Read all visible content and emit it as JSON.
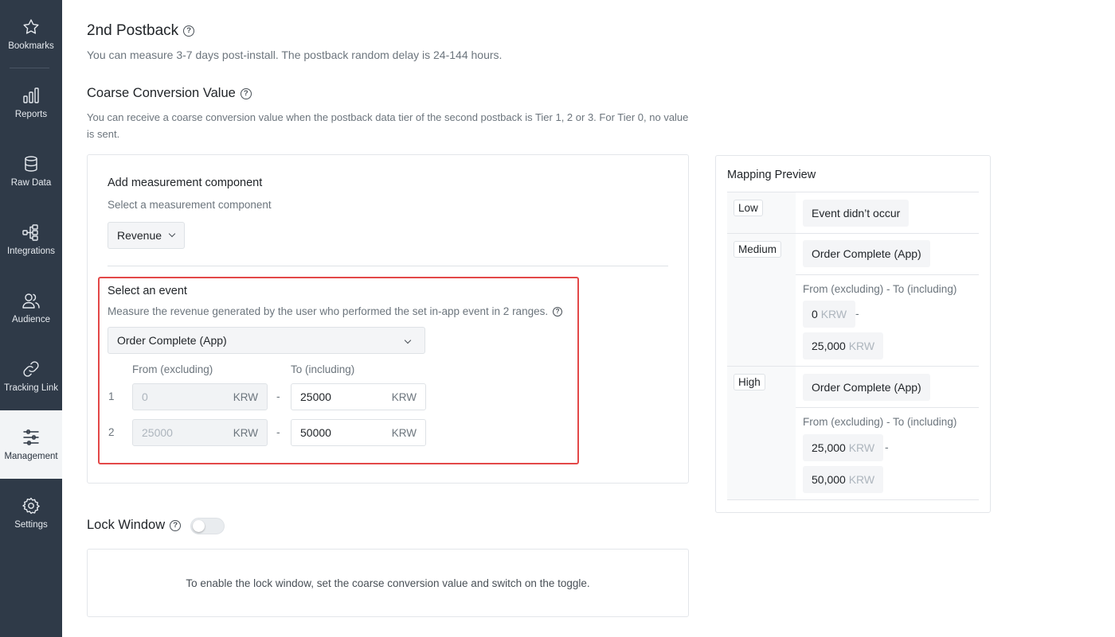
{
  "sidebar": {
    "items": [
      {
        "label": "Bookmarks",
        "icon": "star-icon"
      },
      {
        "label": "Reports",
        "icon": "bar-chart-icon"
      },
      {
        "label": "Raw Data",
        "icon": "database-icon"
      },
      {
        "label": "Integrations",
        "icon": "integrations-icon"
      },
      {
        "label": "Audience",
        "icon": "users-icon"
      },
      {
        "label": "Tracking Link",
        "icon": "link-icon"
      },
      {
        "label": "Management",
        "icon": "sliders-icon",
        "active": true
      },
      {
        "label": "Settings",
        "icon": "gear-icon"
      }
    ]
  },
  "postback": {
    "title": "2nd Postback",
    "subtitle": "You can measure 3-7 days post-install. The postback random delay is 24-144 hours."
  },
  "coarse": {
    "title": "Coarse Conversion Value",
    "description": "You can receive a coarse conversion value when the postback data tier of the second postback is Tier 1, 2 or 3. For Tier 0, no value is sent.",
    "add_component_label": "Add measurement component",
    "select_component_hint": "Select a measurement component",
    "component_value": "Revenue",
    "select_event_label": "Select an event",
    "select_event_desc": "Measure the revenue generated by the user who performed the set in-app event in 2 ranges.",
    "event_value": "Order Complete (App)",
    "from_header": "From (excluding)",
    "to_header": "To (including)",
    "ranges": [
      {
        "no": "1",
        "from": "0",
        "to": "25000",
        "unit": "KRW"
      },
      {
        "no": "2",
        "from": "25000",
        "to": "50000",
        "unit": "KRW"
      }
    ],
    "dash": "-"
  },
  "lock_window": {
    "title": "Lock Window",
    "enabled": false,
    "message": "To enable the lock window, set the coarse conversion value and switch on the toggle."
  },
  "mapping_preview": {
    "title": "Mapping Preview",
    "low": {
      "tier": "Low",
      "event": "Event didn’t occur"
    },
    "medium": {
      "tier": "Medium",
      "event": "Order Complete (App)",
      "range_label": "From (excluding) - To (including)",
      "from": "0",
      "to": "25,000",
      "unit": "KRW"
    },
    "high": {
      "tier": "High",
      "event": "Order Complete (App)",
      "range_label": "From (excluding) - To (including)",
      "from": "25,000",
      "to": "50,000",
      "unit": "KRW"
    },
    "dash": "-"
  },
  "colors": {
    "sidebar_bg": "#2f3a48",
    "highlight_border": "#e34848",
    "active_nav_bg": "#f2f4f6"
  }
}
